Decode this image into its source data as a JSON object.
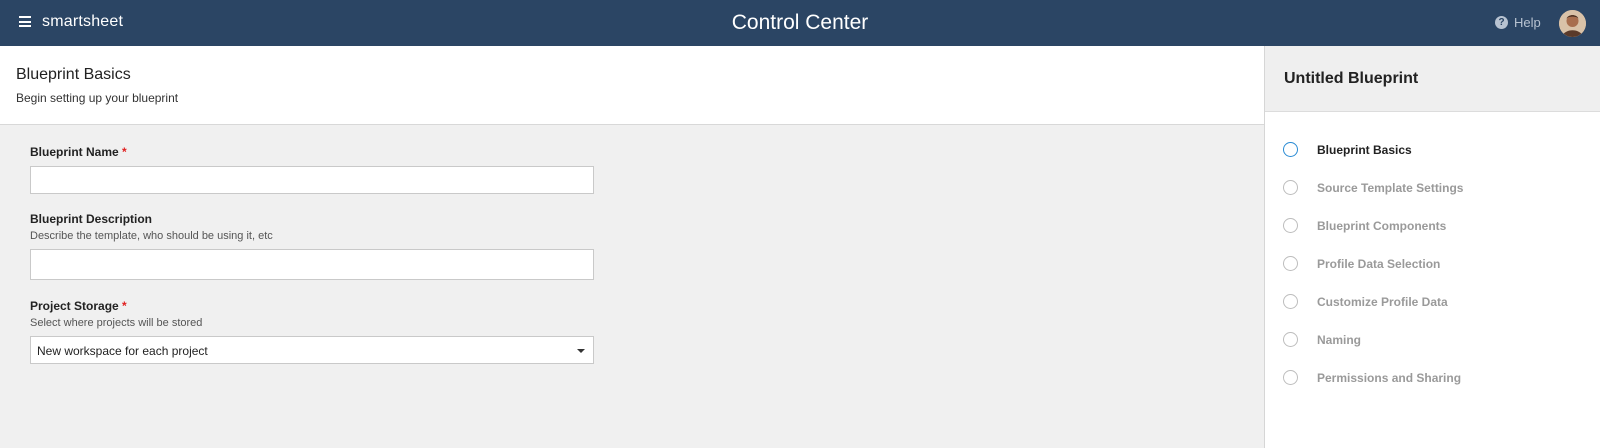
{
  "header": {
    "brand": "smartsheet",
    "title": "Control Center",
    "help_label": "Help"
  },
  "page": {
    "title": "Blueprint Basics",
    "subtitle": "Begin setting up your blueprint"
  },
  "form": {
    "name_label": "Blueprint Name",
    "name_value": "",
    "description_label": "Blueprint Description",
    "description_hint": "Describe the template, who should be using it, etc",
    "description_value": "",
    "storage_label": "Project Storage",
    "storage_hint": "Select where projects will be stored",
    "storage_value": "New workspace for each project",
    "required_mark": "*"
  },
  "sidebar": {
    "title": "Untitled Blueprint",
    "steps": [
      {
        "label": "Blueprint Basics",
        "active": true
      },
      {
        "label": "Source Template Settings",
        "active": false
      },
      {
        "label": "Blueprint Components",
        "active": false
      },
      {
        "label": "Profile Data Selection",
        "active": false
      },
      {
        "label": "Customize Profile Data",
        "active": false
      },
      {
        "label": "Naming",
        "active": false
      },
      {
        "label": "Permissions and Sharing",
        "active": false
      }
    ]
  },
  "colors": {
    "topbar": "#2b4564",
    "active_step": "#2a8bd4",
    "required": "#e02020"
  }
}
